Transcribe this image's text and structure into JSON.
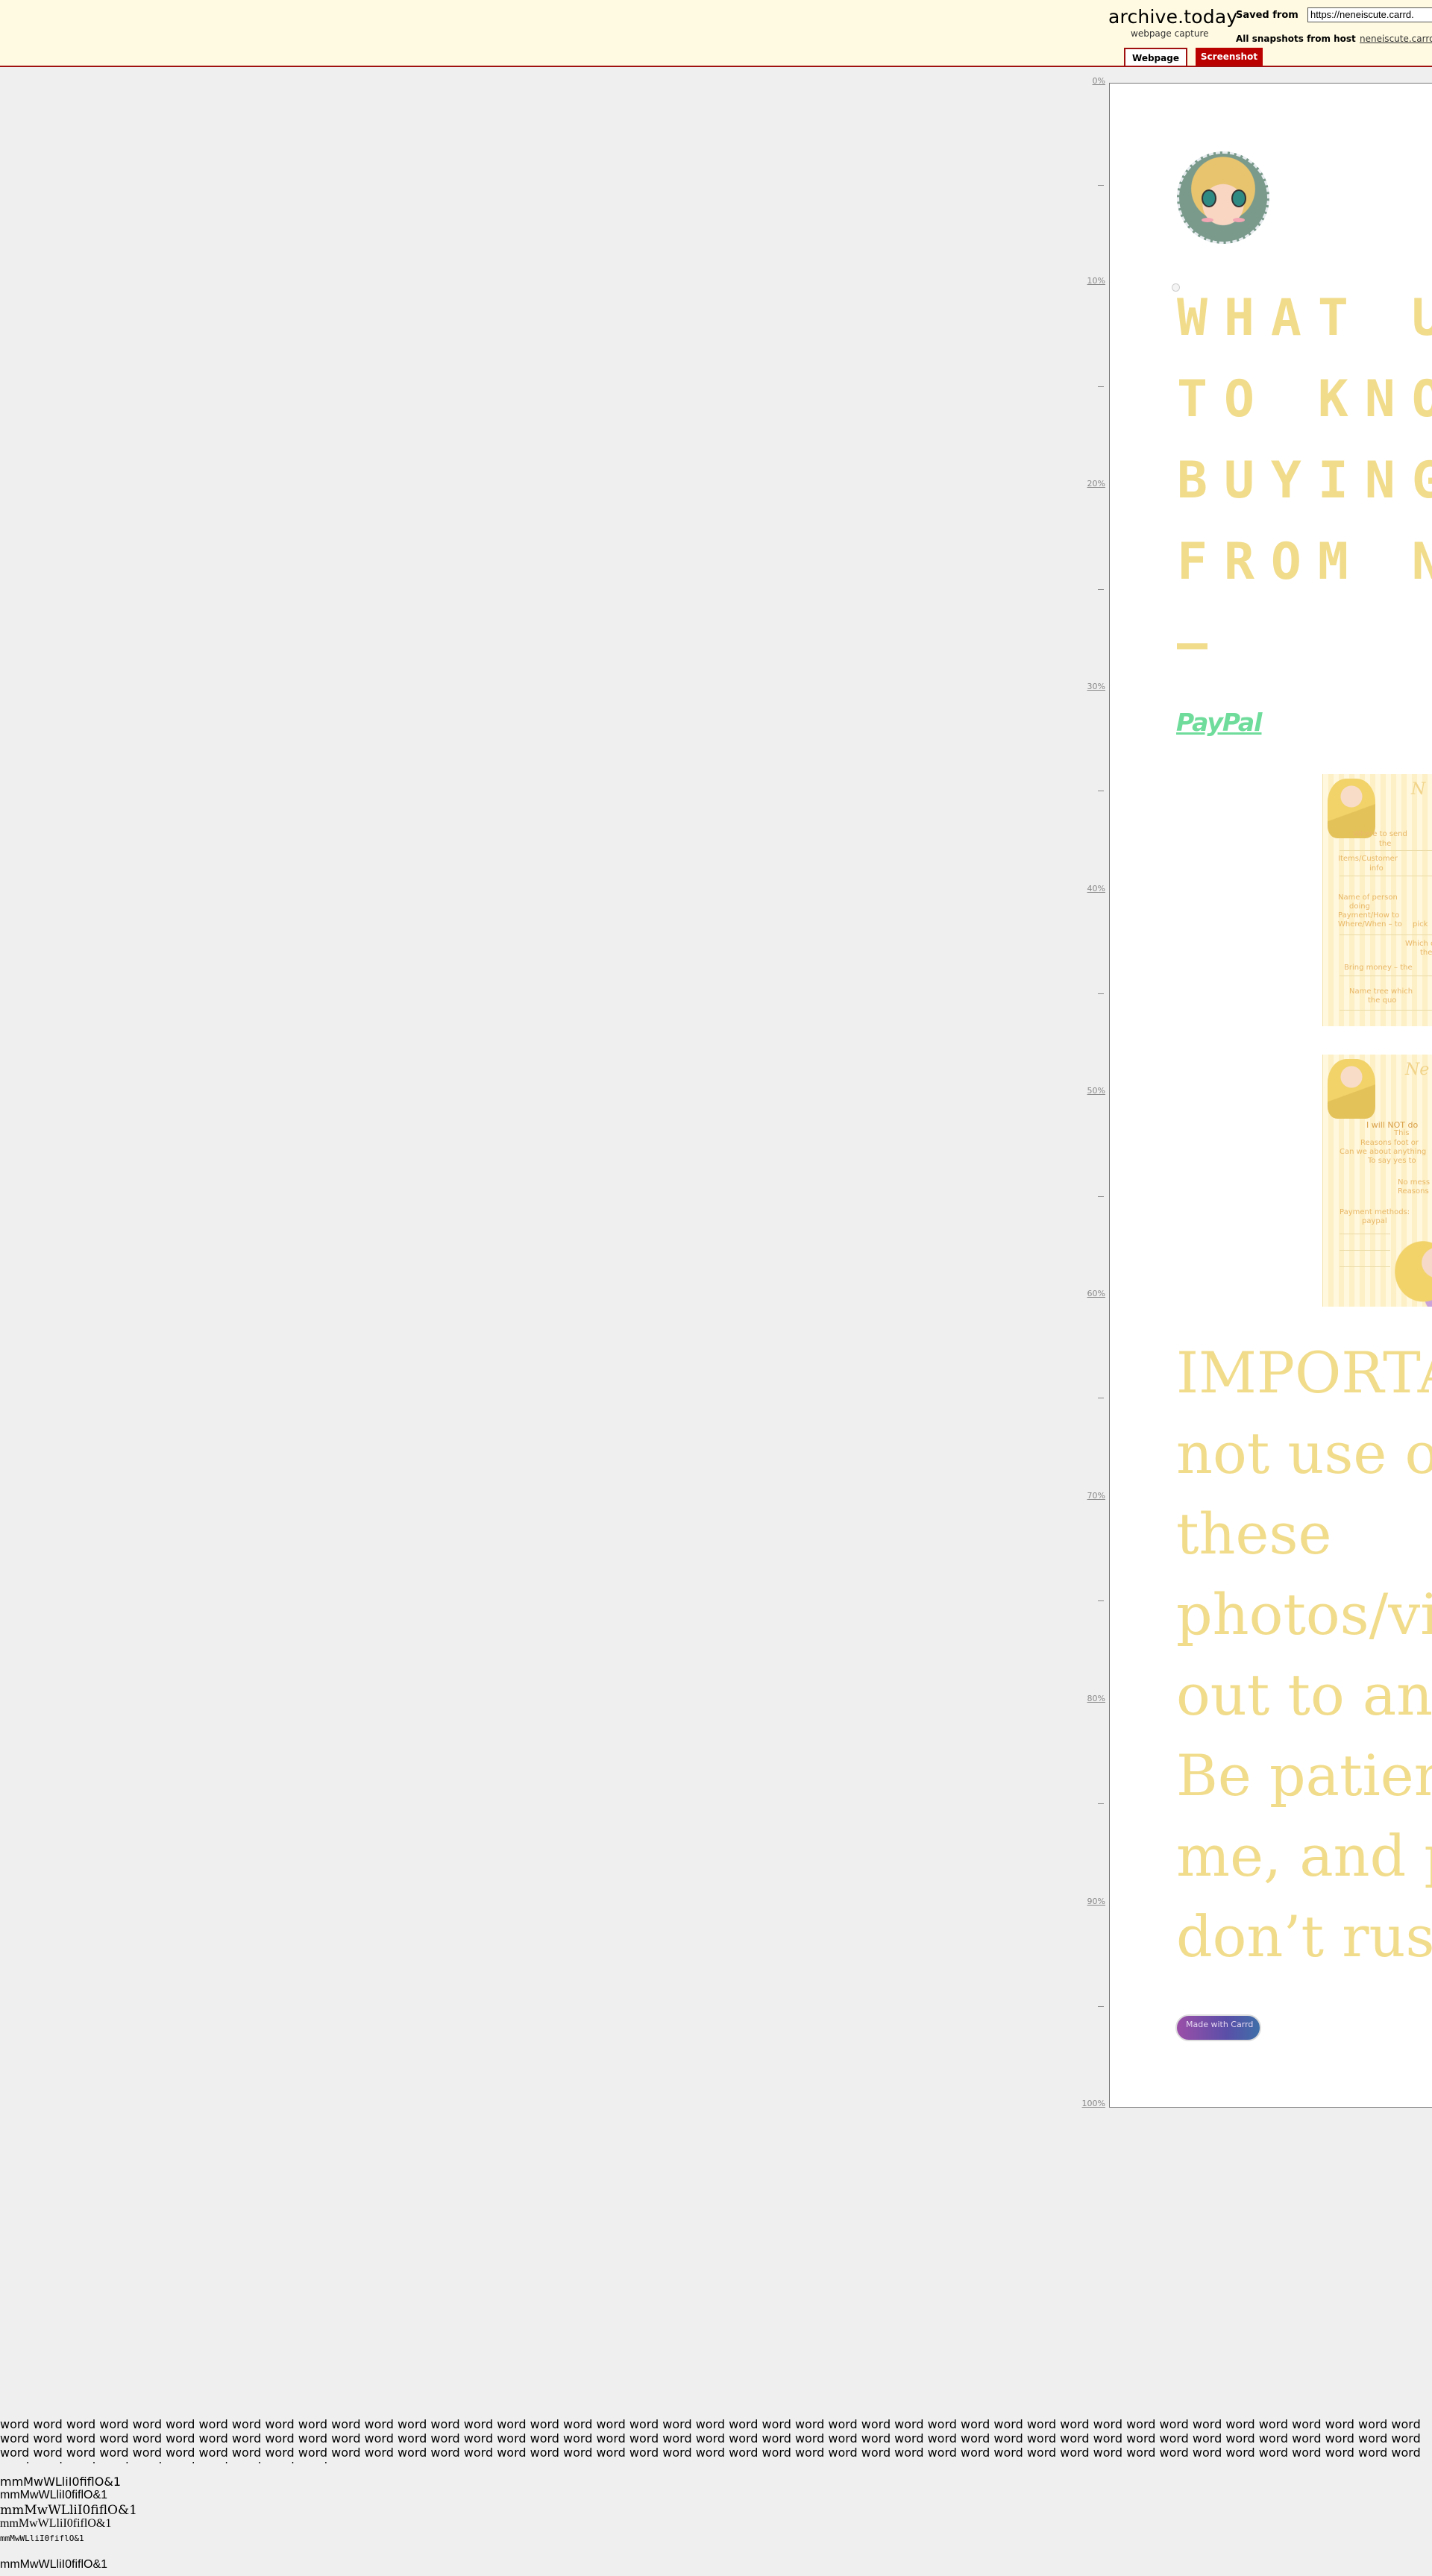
{
  "archive": {
    "logo": "archive.today",
    "subtitle": "webpage capture",
    "saved_from_label": "Saved from",
    "saved_url": "https://neneiscute.carrd.",
    "all_snapshots_label": "All snapshots",
    "from_host_label": "from host",
    "host_link": "neneiscute.carrd",
    "tabs": [
      {
        "label": "Webpage",
        "active": true
      },
      {
        "label": "Screenshot",
        "active": false
      }
    ],
    "accent_color": "#a01010"
  },
  "scale": {
    "ticks": [
      "0%",
      "—",
      "10%",
      "—",
      "20%",
      "—",
      "30%",
      "—",
      "40%",
      "—",
      "50%",
      "—",
      "60%",
      "—",
      "70%",
      "—",
      "80%",
      "—",
      "90%",
      "—",
      "100%"
    ]
  },
  "page": {
    "avatar_alt": "avatar",
    "headline": "WHAT U\nTO KNO\nBUYING\nFROM N\n–",
    "paypal_label": "PayPal",
    "card1": {
      "title": "N",
      "lines": [
        "Where to send",
        "the",
        "Items/Customer",
        "info",
        "Name of person",
        "doing",
        "Payment/How to",
        "Where/When – to",
        "pick",
        "Which one",
        "the state",
        "Bring money – the",
        "Name tree which",
        "the quo"
      ]
    },
    "card2": {
      "title": "Ne",
      "lines": [
        "I will NOT do",
        "This",
        "Reasons foot or",
        "Can we about anything",
        "To say yes to",
        "No mess",
        "Reasons",
        "Payment methods:",
        "paypal"
      ]
    },
    "important_text": "IMPORTA\nnot use o\nthese\nphotos/vi\nout to an\nBe patien\nme, and p\ndon’t rush",
    "carrd_button": "Made with Carrd",
    "text_color": "#f1dc8c",
    "link_color": "#6fdc9b"
  },
  "footer": {
    "words": "word word word word word word word word word word word word word word word word word word word word word word word word word word word word word word word word word word word word word word word word word word word word word word word word word word word word word word word word word word word word word word word word word word word word word word word word word word word word word word word word word word word word word word word word word word word word word word word word word word word word word word word word word word word word word word word word word word word word word word word word word word word word word word word word word word word word word word word word word word word",
    "font_test_lines": [
      "mmMwWLliI0fiflO&1",
      "mmMwWLliI0fiflO&1",
      "mmMwWLliI0fiflO&1",
      "mmMwWLliI0fiflO&1",
      "mmMwWLliI0fiflO&1",
      "mmMwWLliI0fiflO&1"
    ]
  }
}
